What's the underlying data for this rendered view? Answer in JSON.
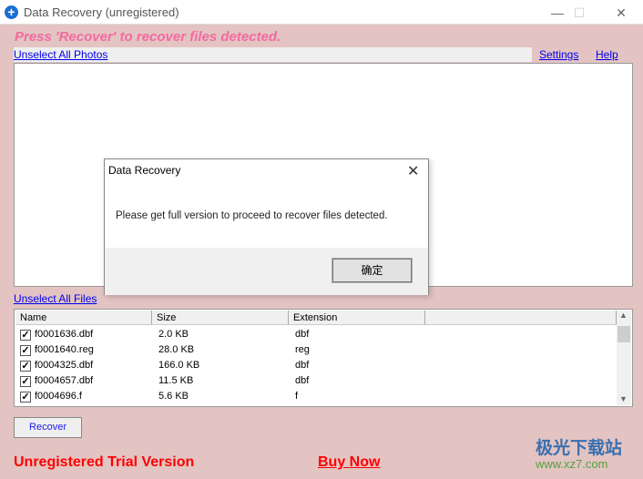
{
  "window": {
    "title": "Data Recovery (unregistered)",
    "minimize": "—",
    "maximize": "☐",
    "close": "✕"
  },
  "headline": "Press 'Recover' to recover files detected.",
  "links": {
    "unselect_photos": "Unselect All Photos",
    "settings": "Settings",
    "help": "Help",
    "unselect_files": "Unselect All Files"
  },
  "dialog": {
    "title": "Data Recovery",
    "close": "✕",
    "message": "Please get full version to proceed to recover files detected.",
    "ok": "确定"
  },
  "list": {
    "columns": [
      "Name",
      "Size",
      "Extension"
    ],
    "rows": [
      {
        "name": "f0001636.dbf",
        "size": "2.0 KB",
        "ext": "dbf",
        "checked": true
      },
      {
        "name": "f0001640.reg",
        "size": "28.0 KB",
        "ext": "reg",
        "checked": true
      },
      {
        "name": "f0004325.dbf",
        "size": "166.0 KB",
        "ext": "dbf",
        "checked": true
      },
      {
        "name": "f0004657.dbf",
        "size": "11.5 KB",
        "ext": "dbf",
        "checked": true
      },
      {
        "name": "f0004696.f",
        "size": "5.6 KB",
        "ext": "f",
        "checked": true
      }
    ]
  },
  "recover_label": "Recover",
  "footer": {
    "trial": "Unregistered Trial Version",
    "buy": "Buy Now"
  },
  "watermark": {
    "name": "极光下载站",
    "url": "www.xz7.com"
  }
}
